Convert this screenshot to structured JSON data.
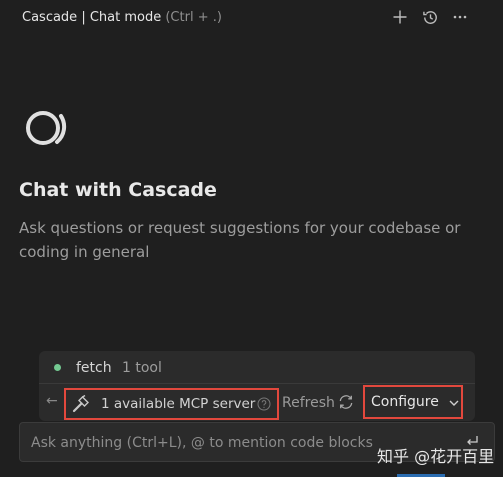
{
  "header": {
    "title": "Cascade | Chat mode",
    "shortcut": "(Ctrl + .)",
    "icons": [
      "plus-icon",
      "history-icon",
      "more-icon"
    ]
  },
  "welcome": {
    "heading": "Chat with Cascade",
    "description": "Ask questions or request suggestions for your codebase or coding in general"
  },
  "mcp": {
    "server_name": "fetch",
    "tool_count": "1 tool",
    "status_color": "#73c991",
    "available_label": "1 available MCP server",
    "refresh_label": "Refresh",
    "configure_label": "Configure"
  },
  "input": {
    "placeholder": "Ask anything (Ctrl+L), @ to mention code blocks"
  },
  "watermark": "知乎 @花开百里",
  "colors": {
    "background": "#1f1f1f",
    "panel": "#2b2b2b",
    "highlight": "#e2483d",
    "accent": "#2a6cb0"
  }
}
